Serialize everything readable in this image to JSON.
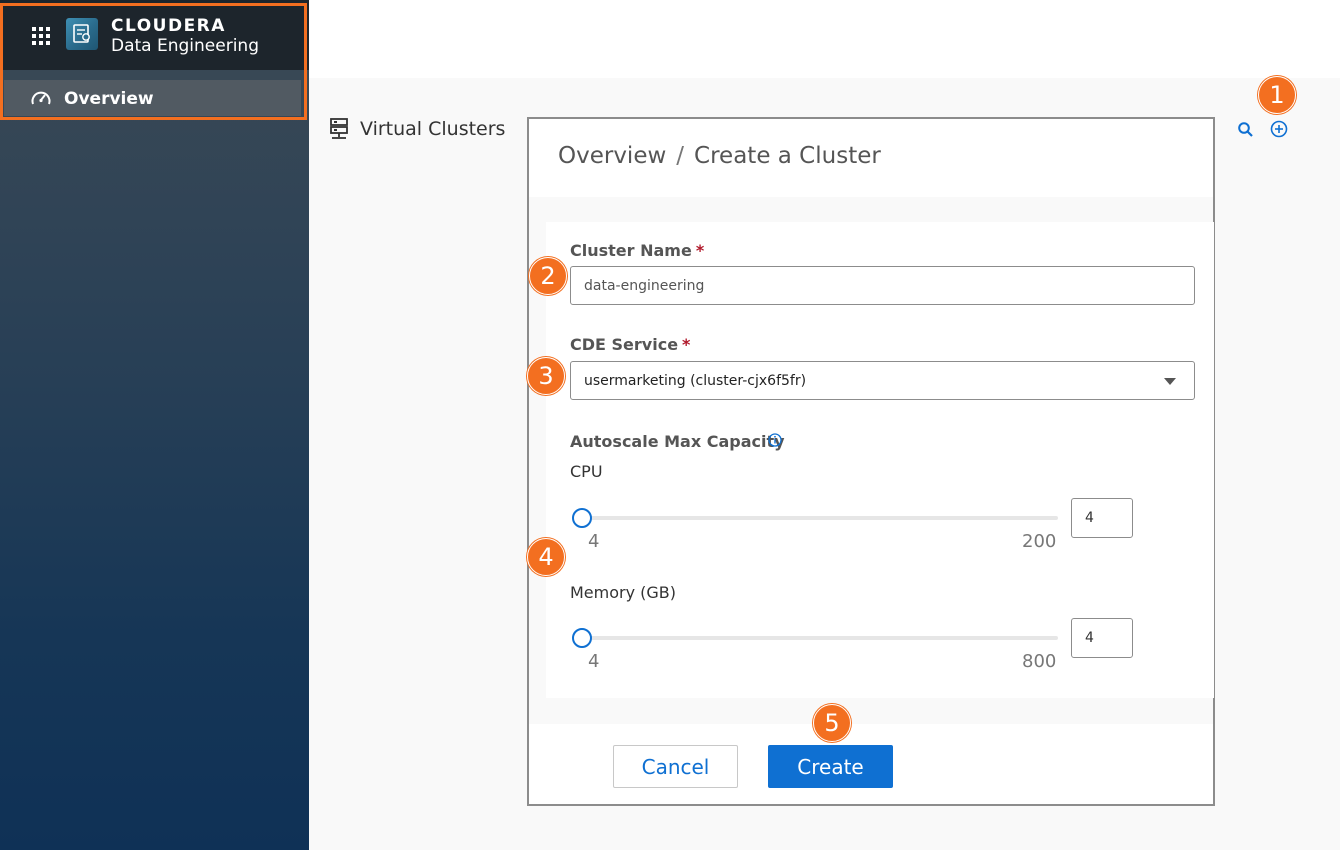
{
  "sidebar": {
    "brand_top": "CLOUDERA",
    "brand_sub": "Data Engineering",
    "nav_overview": "Overview"
  },
  "main": {
    "section_title": "Virtual Clusters"
  },
  "modal": {
    "breadcrumb_root": "Overview",
    "breadcrumb_sep": "/",
    "breadcrumb_current": "Create a Cluster",
    "cluster_name_label": "Cluster Name",
    "required_mark": "*",
    "cluster_name_value": "data-engineering",
    "cde_service_label": "CDE Service",
    "cde_service_value": "usermarketing (cluster-cjx6f5fr)",
    "autoscale_label": "Autoscale Max Capacity",
    "cpu": {
      "label": "CPU",
      "min": "4",
      "max": "200",
      "value": "4",
      "fraction": 0
    },
    "memory": {
      "label": "Memory (GB)",
      "min": "4",
      "max": "800",
      "value": "4",
      "fraction": 0
    },
    "cancel_label": "Cancel",
    "create_label": "Create"
  },
  "callouts": [
    "1",
    "2",
    "3",
    "4",
    "5"
  ],
  "colors": {
    "accent_blue": "#0f70d2",
    "callout_orange": "#f36f20",
    "sidebar_dark": "#1d252c",
    "required_red": "#b0182a"
  },
  "icons": {
    "apps": "grid-icon",
    "logo": "data-engineering-logo-icon",
    "overview": "gauge-icon",
    "section": "server-icon",
    "search": "search-icon",
    "add": "add-circle-icon",
    "info": "info-icon",
    "dropdown": "chevron-down-icon"
  }
}
